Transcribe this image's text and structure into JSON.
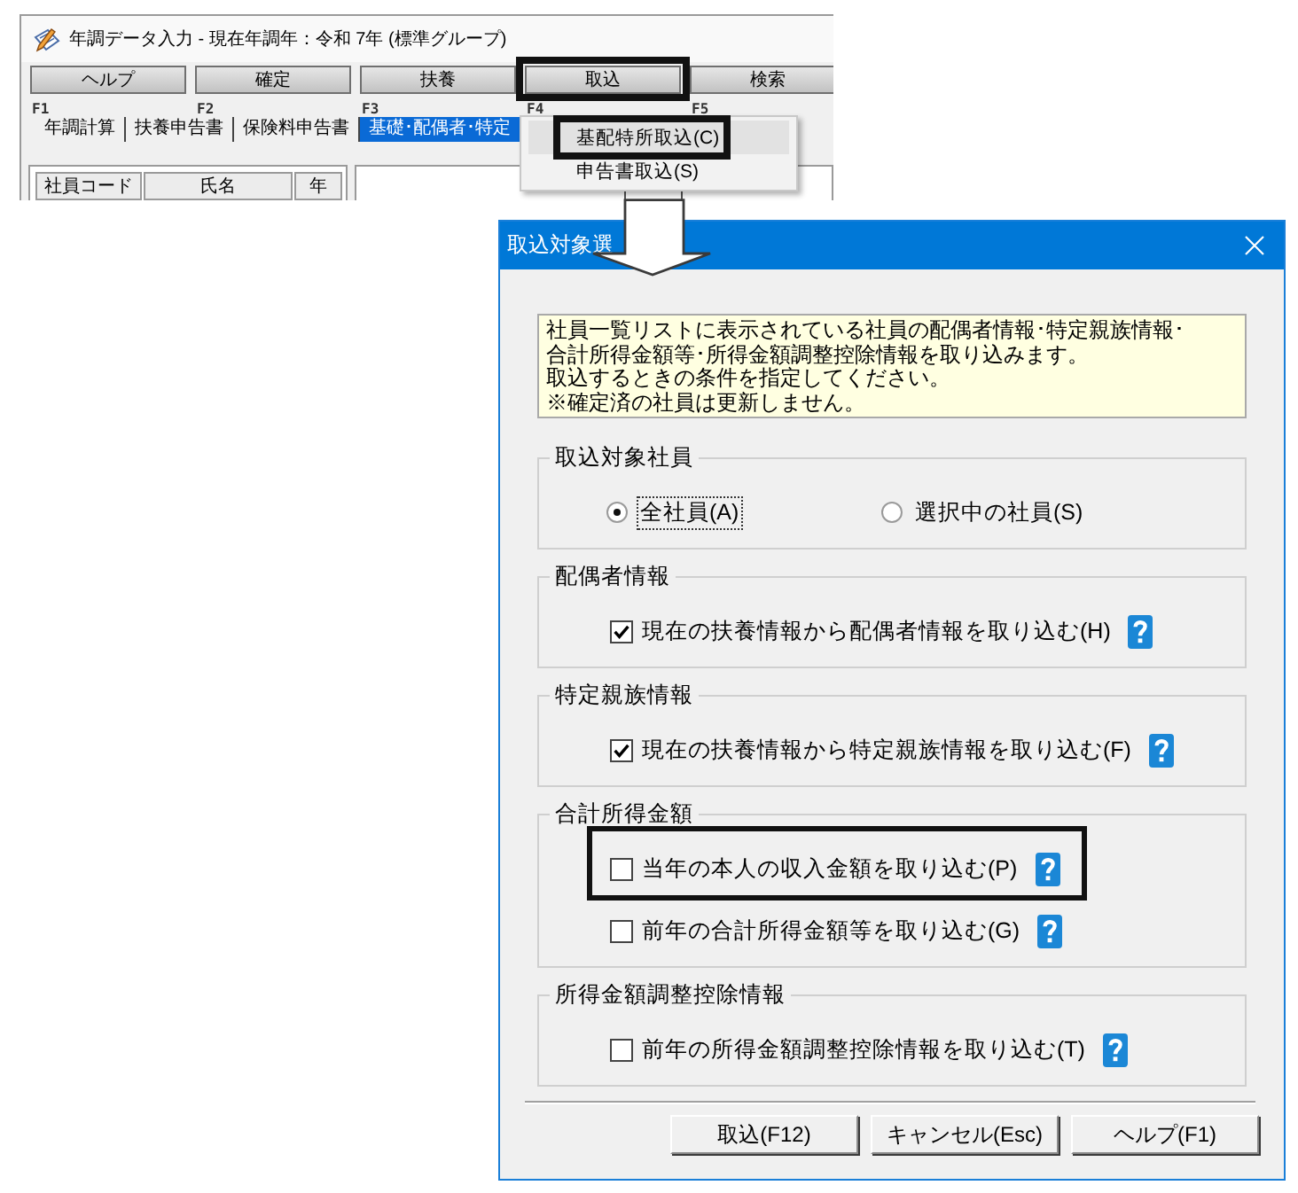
{
  "app_window": {
    "title": "年調データ入力 - 現在年調年：令和 7年 (標準グループ)",
    "function_keys": [
      {
        "label": "ヘルプ",
        "key": "F1",
        "framed": false
      },
      {
        "label": "確定",
        "key": "F2",
        "framed": false
      },
      {
        "label": "扶養",
        "key": "F3",
        "framed": false
      },
      {
        "label": "取込",
        "key": "F4",
        "framed": true
      },
      {
        "label": "検索",
        "key": "F5",
        "framed": false
      }
    ],
    "tabs": [
      {
        "label": "年調計算",
        "selected": false
      },
      {
        "label": "扶養申告書",
        "selected": false
      },
      {
        "label": "保険料申告書",
        "selected": false
      },
      {
        "label": "基礎･配偶者･特定",
        "selected": true
      }
    ],
    "employee_list": {
      "columns": [
        "社員コード",
        "氏名",
        "年"
      ]
    }
  },
  "dropdown_menu": {
    "items": [
      {
        "label": "基配特所取込(C)",
        "selected": true,
        "framed": true
      },
      {
        "label": "申告書取込(S)",
        "selected": false,
        "framed": false
      }
    ]
  },
  "dialog": {
    "title": "取込対象選",
    "notice": [
      "社員一覧リストに表示されている社員の配偶者情報･特定親族情報･合計所得金額等･所得金額調整控除情報を取り込みます。",
      "取込するときの条件を指定してください。",
      "※確定済の社員は更新しません。"
    ],
    "groups": [
      {
        "title": "取込対象社員",
        "kind": "radio",
        "options": [
          {
            "label": "全社員(A)",
            "selected": true,
            "focused": true
          },
          {
            "label": "選択中の社員(S)",
            "selected": false,
            "focused": false
          }
        ]
      },
      {
        "title": "配偶者情報",
        "kind": "checkbox",
        "options": [
          {
            "label": "現在の扶養情報から配偶者情報を取り込む(H)",
            "checked": true,
            "framed": false
          }
        ]
      },
      {
        "title": "特定親族情報",
        "kind": "checkbox",
        "options": [
          {
            "label": "現在の扶養情報から特定親族情報を取り込む(F)",
            "checked": true,
            "framed": false
          }
        ]
      },
      {
        "title": "合計所得金額",
        "kind": "checkbox",
        "options": [
          {
            "label": "当年の本人の収入金額を取り込む(P)",
            "checked": false,
            "framed": true
          },
          {
            "label": "前年の合計所得金額等を取り込む(G)",
            "checked": false,
            "framed": false
          }
        ]
      },
      {
        "title": "所得金額調整控除情報",
        "kind": "checkbox",
        "options": [
          {
            "label": "前年の所得金額調整控除情報を取り込む(T)",
            "checked": false,
            "framed": false
          }
        ]
      }
    ],
    "buttons": [
      "取込(F12)",
      "キャンセル(Esc)",
      "ヘルプ(F1)"
    ]
  }
}
